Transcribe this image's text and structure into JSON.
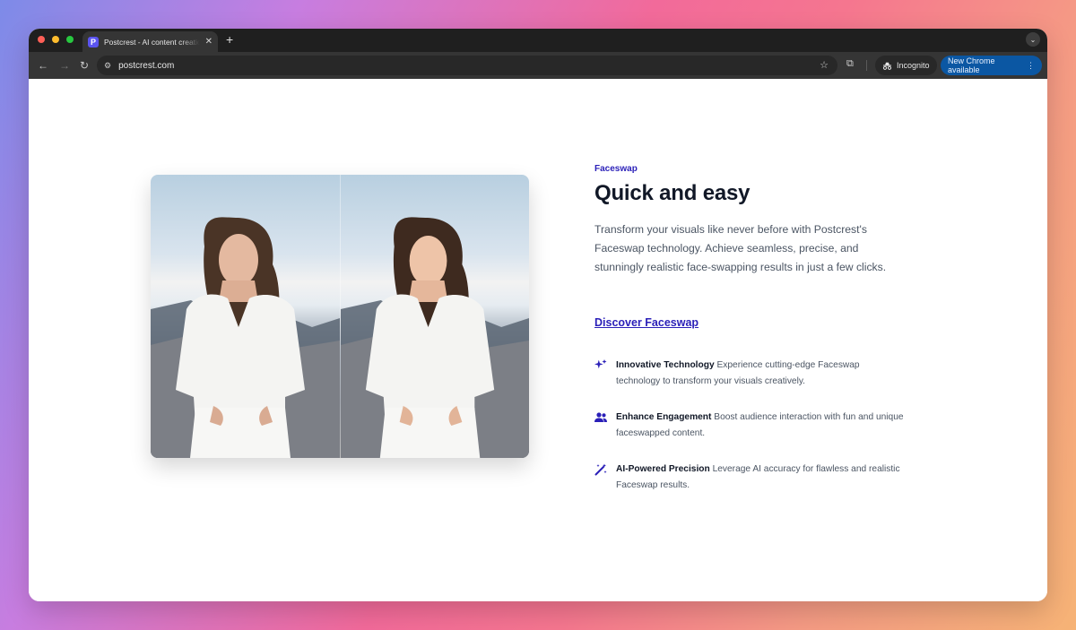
{
  "browser": {
    "tab_title": "Postcrest - AI content creation",
    "favicon_letter": "P",
    "url": "postcrest.com",
    "incognito_label": "Incognito",
    "update_label": "New Chrome available",
    "colors": {
      "update_button": "#0b57a3",
      "toolbar": "#353535",
      "tabstrip": "#1f1f1f"
    }
  },
  "content": {
    "eyebrow": "Faceswap",
    "heading": "Quick and easy",
    "description": "Transform your visuals like never before with Postcrest's Faceswap technology. Achieve seamless, precise, and stunningly realistic face-swapping results in just a few clicks.",
    "link_label": "Discover Faceswap",
    "accent_color": "#2a1fb8",
    "features": [
      {
        "icon": "sparkles-icon",
        "title": "Innovative Technology",
        "text": "Experience cutting-edge Faceswap technology to transform your visuals creatively."
      },
      {
        "icon": "users-icon",
        "title": "Enhance Engagement",
        "text": "Boost audience interaction with fun and unique faceswapped content."
      },
      {
        "icon": "magic-wand-icon",
        "title": "AI-Powered Precision",
        "text": "Leverage AI accuracy for flawless and realistic Faceswap results."
      }
    ]
  }
}
